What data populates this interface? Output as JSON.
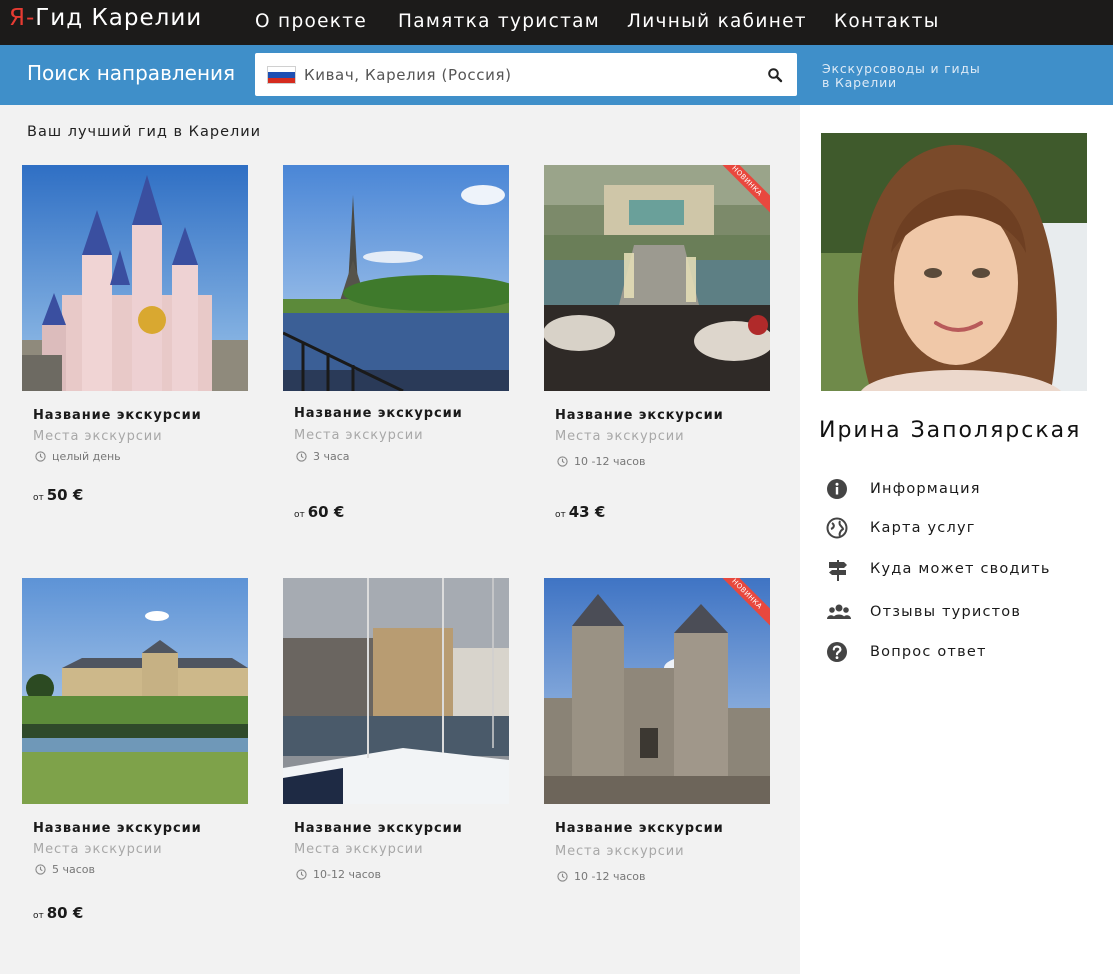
{
  "header": {
    "logo_accent": "Я-",
    "logo_text": "Гид Карелии",
    "nav": [
      "О проекте",
      "Памятка туристам",
      "Личный кабинет",
      "Контакты"
    ]
  },
  "search": {
    "title": "Поиск направления",
    "value": "Кивач, Карелия (Россия)",
    "side_link": "Экскурсоводы и гиды\nв Карелии"
  },
  "main": {
    "subtitle": "Ваш лучший гид в Карелии",
    "cards": [
      {
        "name": "Название экскурсии",
        "place": "Места экскурсии",
        "duration": "целый день",
        "price_prefix": "от",
        "price": "50 €",
        "badge": ""
      },
      {
        "name": "Название экскурсии",
        "place": "Места экскурсии",
        "duration": "3 часа",
        "price_prefix": "от",
        "price": "60 €",
        "badge": ""
      },
      {
        "name": "Название экскурсии",
        "place": "Места экскурсии",
        "duration": "10 -12 часов",
        "price_prefix": "от",
        "price": "43 €",
        "badge": "НОВИНКА"
      },
      {
        "name": "Название экскурсии",
        "place": "Места экскурсии",
        "duration": "5 часов",
        "price_prefix": "от",
        "price": "80 €",
        "badge": ""
      },
      {
        "name": "Название экскурсии",
        "place": "Места экскурсии",
        "duration": "10-12 часов",
        "price_prefix": "",
        "price": "",
        "badge": ""
      },
      {
        "name": "Название экскурсии",
        "place": "Места экскурсии",
        "duration": "10 -12 часов",
        "price_prefix": "",
        "price": "",
        "badge": "НОВИНКА"
      }
    ]
  },
  "guide": {
    "name": "Ирина Заполярская",
    "menu": [
      {
        "label": "Информация",
        "icon": "info-icon"
      },
      {
        "label": "Карта услуг",
        "icon": "globe-icon"
      },
      {
        "label": "Куда может сводить",
        "icon": "signpost-icon"
      },
      {
        "label": "Отзывы туристов",
        "icon": "people-icon"
      },
      {
        "label": "Вопрос ответ",
        "icon": "question-icon"
      }
    ]
  },
  "colors": {
    "topbar": "#1c1b1a",
    "accent": "#e63b32",
    "search_bar": "#3f8fc9",
    "main_bg": "#f2f2f2",
    "badge": "#e8483e"
  }
}
